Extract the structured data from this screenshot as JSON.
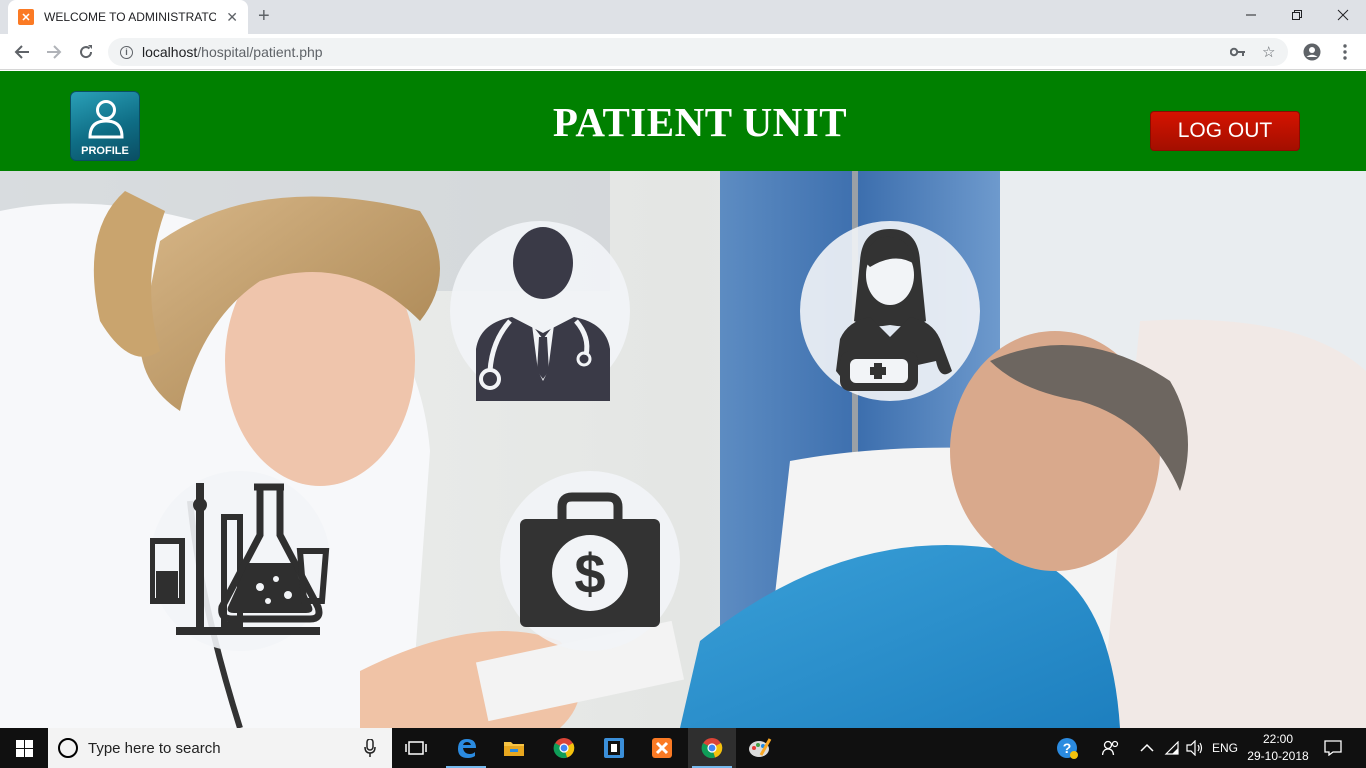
{
  "browser": {
    "tab_title": "WELCOME TO ADMINISTRATOR U",
    "url_host": "localhost",
    "url_path": "/hospital/patient.php"
  },
  "header": {
    "profile_label": "PROFILE",
    "title": "PATIENT UNIT",
    "logout_label": "LOG OUT"
  },
  "tiles": [
    {
      "icon": "doctor-icon"
    },
    {
      "icon": "nurse-icon"
    },
    {
      "icon": "laboratory-icon"
    },
    {
      "icon": "billing-icon"
    }
  ],
  "taskbar": {
    "search_placeholder": "Type here to search",
    "language": "ENG",
    "time": "22:00",
    "date": "29-10-2018"
  },
  "colors": {
    "header_green": "#008000",
    "logout_red": "#c01100",
    "icon_dark": "#3a3a47"
  }
}
